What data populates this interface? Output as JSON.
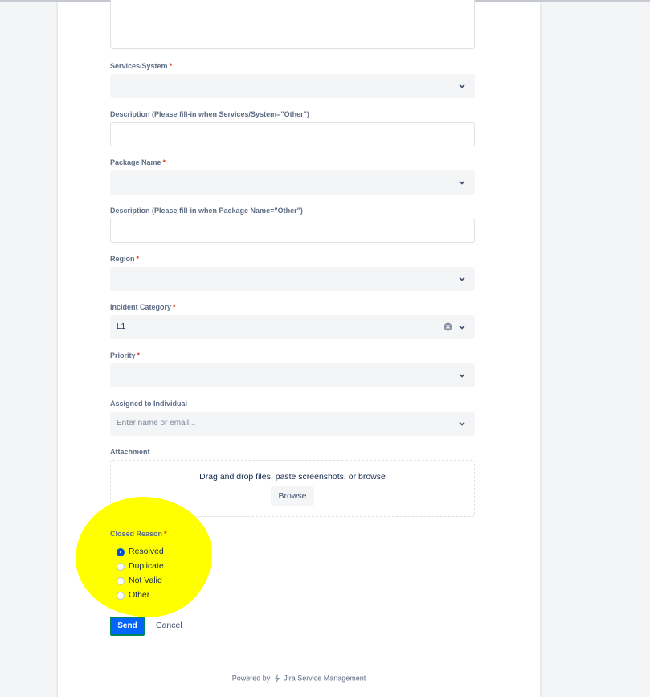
{
  "form": {
    "fields": {
      "services_system": {
        "label": "Services/System",
        "required_mark": "*"
      },
      "services_description": {
        "label": "Description (Please fill-in when Services/System=\"Other\")"
      },
      "package_name": {
        "label": "Package Name",
        "required_mark": "*"
      },
      "package_description": {
        "label": "Description (Please fill-in when Package Name=\"Other\")"
      },
      "region": {
        "label": "Region",
        "required_mark": "*"
      },
      "incident_category": {
        "label": "Incident Category",
        "required_mark": "*",
        "value": "L1"
      },
      "priority": {
        "label": "Priority",
        "required_mark": "*"
      },
      "assigned_to": {
        "label": "Assigned to Individual",
        "placeholder": "Enter name or email..."
      },
      "attachment": {
        "label": "Attachment",
        "dropzone_text": "Drag and drop files, paste screenshots, or browse",
        "browse_label": "Browse"
      },
      "closed_reason": {
        "label": "Closed Reason",
        "required_mark": "*",
        "options": [
          {
            "label": "Resolved",
            "checked": true
          },
          {
            "label": "Duplicate",
            "checked": false
          },
          {
            "label": "Not Valid",
            "checked": false
          },
          {
            "label": "Other",
            "checked": false
          }
        ]
      }
    },
    "actions": {
      "send_label": "Send",
      "cancel_label": "Cancel"
    }
  },
  "footer": {
    "powered_by": "Powered by",
    "product": "Jira Service Management"
  },
  "colors": {
    "primary": "#0052cc",
    "send_button": "#0065ff",
    "send_border": "#00875a",
    "required": "#de350b",
    "highlight": "#ffff00"
  },
  "icons": {
    "select_chevron": "chevron-down-icon",
    "clear": "clear-icon",
    "footer_logo": "jira-bolt-icon"
  }
}
